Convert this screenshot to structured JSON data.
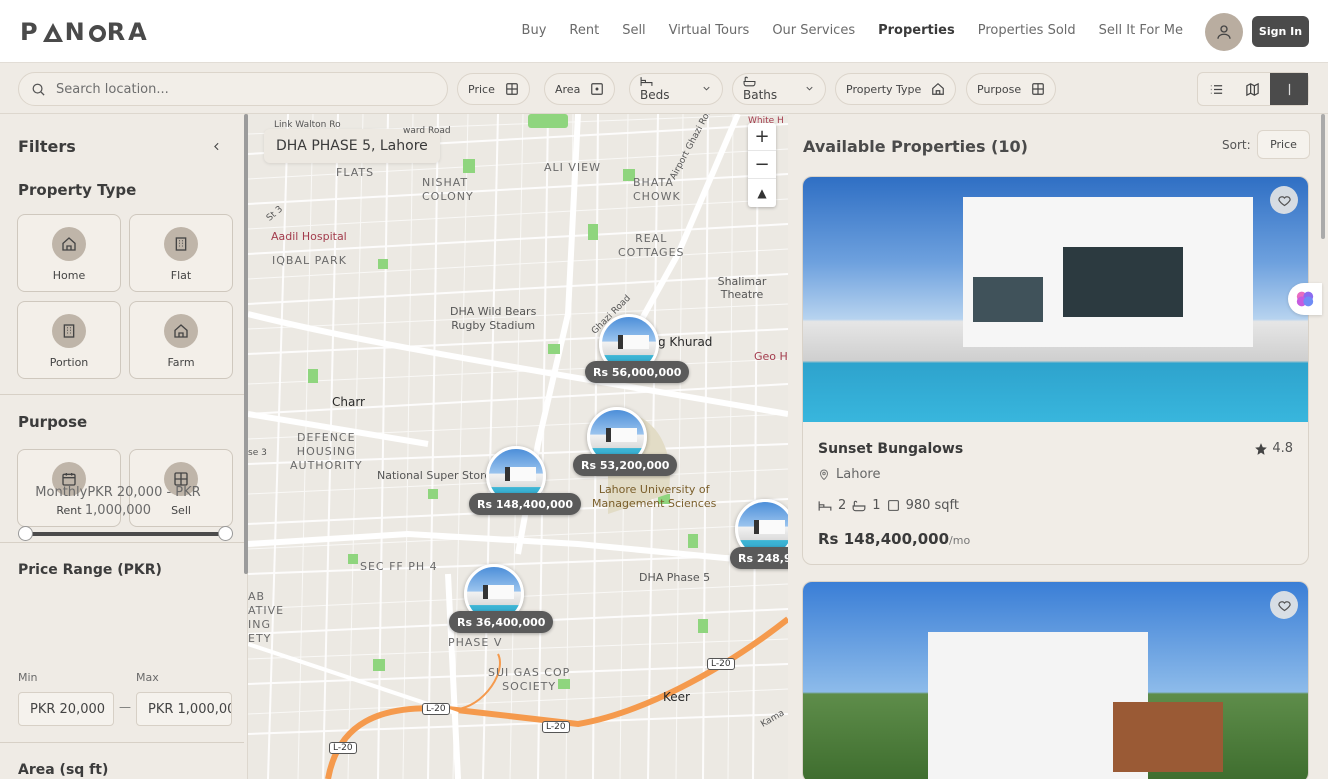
{
  "header": {
    "logo": "PANORA",
    "nav": [
      "Buy",
      "Rent",
      "Sell",
      "Virtual Tours",
      "Our Services",
      "Properties",
      "Properties Sold",
      "Sell It For Me"
    ],
    "active_nav": "Properties",
    "sign_in": "Sign In"
  },
  "filterbar": {
    "search_placeholder": "Search location...",
    "price": "Price",
    "area": "Area",
    "beds": "Beds",
    "baths": "Baths",
    "property_type": "Property Type",
    "purpose": "Purpose"
  },
  "sidebar": {
    "title": "Filters",
    "property_type_title": "Property Type",
    "property_types": [
      "Home",
      "Flat",
      "Portion",
      "Farm"
    ],
    "purpose_title": "Purpose",
    "purposes": [
      "Rent",
      "Sell"
    ],
    "price_range_title": "Price Range (PKR)",
    "price_range_text": "MonthlyPKR 20,000 - PKR 1,000,000",
    "price_range_min_fraction": 0,
    "price_range_max_fraction": 1,
    "min_label": "Min",
    "max_label": "Max",
    "min_value": "PKR 20,000",
    "max_value": "PKR 1,000,000",
    "separator": "—",
    "area_title": "Area (sq ft)"
  },
  "map": {
    "location_label": "DHA PHASE 5, Lahore",
    "places": {
      "link_walton": "Link Walton Ro",
      "ward_road": "ward Road",
      "flats": "FLATS",
      "nishat": "NISHAT\nCOLONY",
      "ali_view": "ALI VIEW",
      "bhata": "BHATA\nCHOWK",
      "airport": "Airport Ghazi Road",
      "white_h": "White H",
      "st3": "St 3",
      "aadil": "Aadil Hospital",
      "iqbal": "IQBAL PARK",
      "real": "REAL\nCOTTAGES",
      "shalimar": "Shalimar Theatre",
      "ghazi": "Ghazi Road",
      "dha_wild": "DHA Wild Bears\nRugby Stadium",
      "khurad": "g Khurad",
      "geo": "Geo H",
      "charr": "Charr",
      "defence": "DEFENCE\nHOUSING\nAUTHORITY",
      "se3": "se 3",
      "national": "National Super Store",
      "lums": "Lahore University of\nManagement Sciences",
      "sec_ff": "SEC FF PH 4",
      "dha5": "DHA Phase 5",
      "phase_v": "PHASE V",
      "sui": "SUI GAS COP\nSOCIETY",
      "keer": "Keer",
      "kama": "Kama",
      "ab": "AB\nATIVE\nING\nETY",
      "l20": "L-20"
    },
    "markers": [
      {
        "price": "Rs 56,000,000"
      },
      {
        "price": "Rs 53,200,000"
      },
      {
        "price": "Rs 148,400,000"
      },
      {
        "price": "Rs 248,9"
      },
      {
        "price": "Rs 36,400,000"
      }
    ]
  },
  "panel": {
    "title": "Available Properties (10)",
    "sort_label": "Sort:",
    "sort_value": "Price",
    "cards": [
      {
        "name": "Sunset Bungalows",
        "rating": "4.8",
        "location": "Lahore",
        "beds": "2",
        "baths": "1",
        "area": "980 sqft",
        "price": "Rs 148,400,000",
        "period": "/mo"
      }
    ]
  },
  "colors": {
    "accent": "#4b4b4b",
    "background": "#f0ece6",
    "map_route": "#f59a4d",
    "map_park": "#8fd57e"
  }
}
